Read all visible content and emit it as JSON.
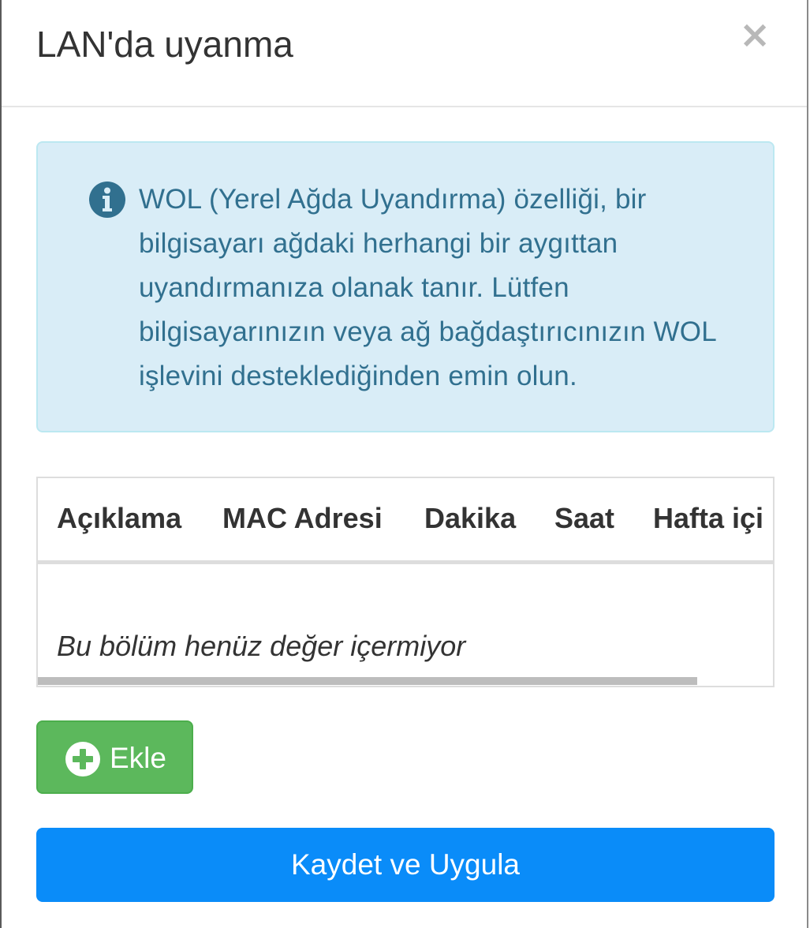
{
  "dialog": {
    "title": "LAN'da uyanma",
    "close_label": "×"
  },
  "info": {
    "icon": "info-circle-icon",
    "text": "WOL (Yerel Ağda Uyandırma) özelliği, bir bilgisayarı ağdaki herhangi bir aygıttan uyandırmanıza olanak tanır. Lütfen bilgisayarınızın veya ağ bağdaştırıcınızın WOL işlevini desteklediğinden emin olun."
  },
  "table": {
    "columns": [
      "Açıklama",
      "MAC Adresi",
      "Dakika",
      "Saat",
      "Hafta içi"
    ],
    "empty_message": "Bu bölüm henüz değer içermiyor"
  },
  "actions": {
    "add_label": "Ekle",
    "add_icon": "plus-circle-icon",
    "save_label": "Kaydet ve Uygula"
  },
  "colors": {
    "info_bg": "#d9edf7",
    "info_text": "#31708f",
    "add_button": "#5cb85c",
    "save_button": "#0a8cf9"
  }
}
